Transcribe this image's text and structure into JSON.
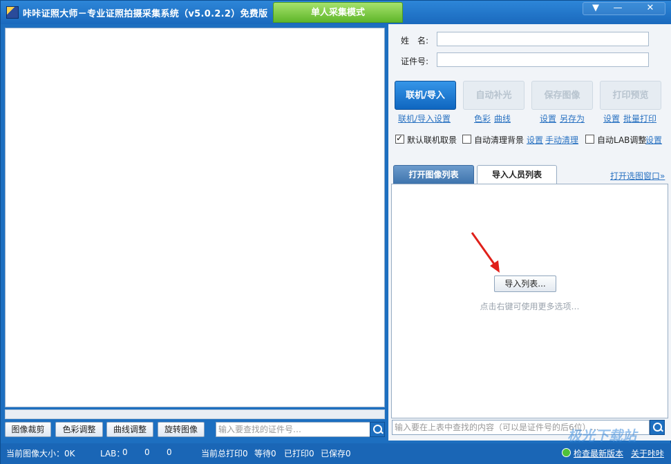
{
  "window": {
    "title": "咔咔证照大师－专业证照拍摄采集系统（v5.0.2.2）免费版",
    "mode": "单人采集模式",
    "menu_glyph": "▼",
    "minimize_glyph": "—",
    "close_glyph": "✕"
  },
  "form": {
    "name_label": "姓　名:",
    "id_label": "证件号:",
    "name_value": "",
    "id_value": ""
  },
  "actions": {
    "connect": "联机/导入",
    "auto_fill": "自动补光",
    "save": "保存图像",
    "print_preview": "打印预览",
    "connect_settings": "联机/导入设置",
    "color": "色彩",
    "curve": "曲线",
    "save_settings": "设置",
    "save_as": "另存为",
    "print_settings": "设置",
    "batch_print": "批量打印"
  },
  "options": {
    "default_capture": "默认联机取景",
    "default_capture_checked": true,
    "auto_clear_bg": "自动清理背景",
    "auto_clear_bg_checked": false,
    "clear_settings": "设置",
    "manual_clear": "手动清理",
    "auto_lab": "自动LAB调整",
    "auto_lab_checked": false,
    "lab_settings": "设置"
  },
  "tabs": {
    "open_list": "打开图像列表",
    "import_list": "导入人员列表",
    "open_window": "打开选图窗口»"
  },
  "list": {
    "import_button": "导入列表...",
    "hint": "点击右键可使用更多选项…",
    "search_placeholder": "输入要在上表中查找的内容（可以是证件号的后6位）…"
  },
  "tools": {
    "crop": "图像裁剪",
    "color_adjust": "色彩调整",
    "curve_adjust": "曲线调整",
    "rotate": "旋转图像",
    "search_placeholder": "输入要查找的证件号…"
  },
  "status": {
    "image_size": "当前图像大小：0K",
    "lab_label": "LAB：",
    "lab_values": [
      "0",
      "0",
      "0"
    ],
    "total_print": "当前总打印0",
    "waiting": "等待0",
    "printed": "已打印0",
    "saved": "已保存0",
    "check_update": "检查最新版本",
    "about": "关于咔咔"
  },
  "watermark": "极光下载站",
  "colors": {
    "titlebar": "#1a69bd",
    "mode_tab": "#5fb62a",
    "primary_button": "#0f66c0",
    "link": "#2b73c2"
  }
}
